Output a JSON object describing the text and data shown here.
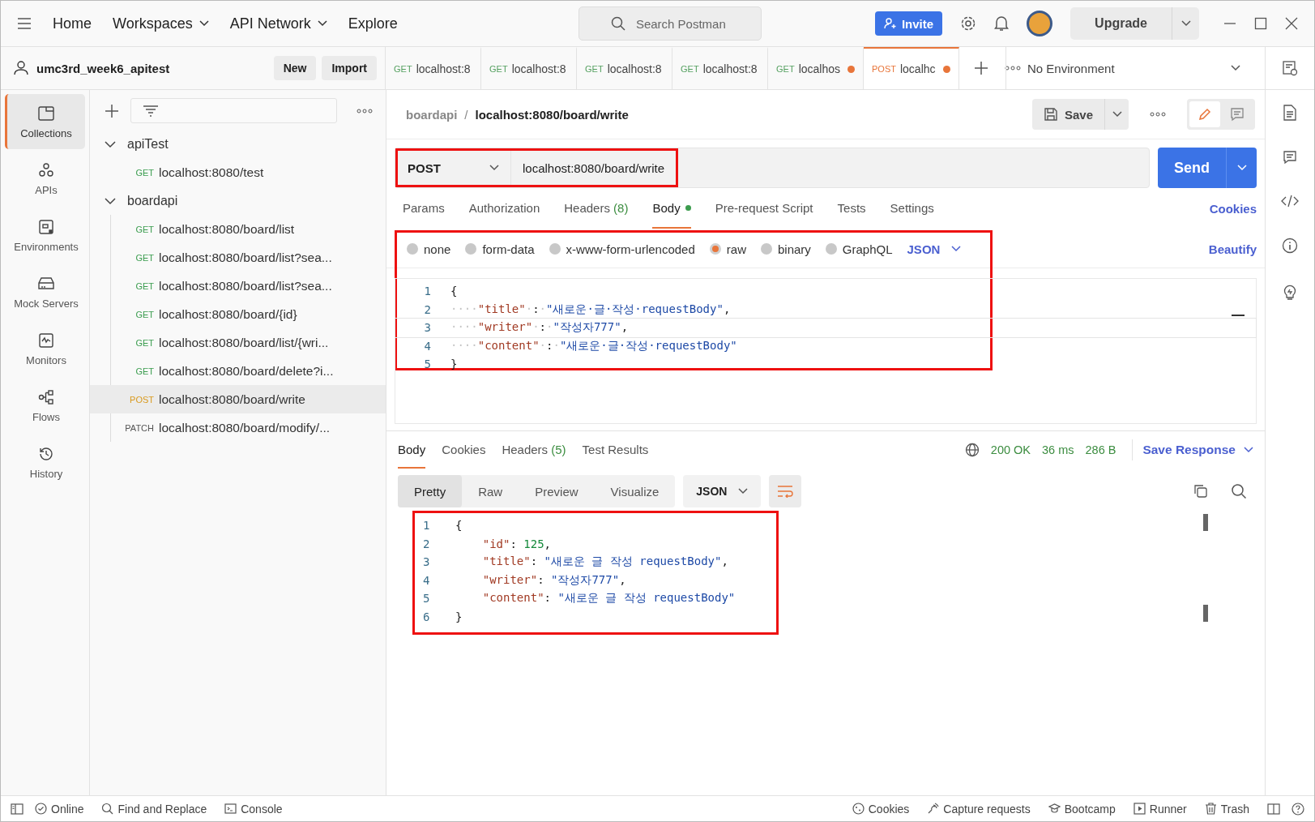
{
  "top_bar": {
    "nav": [
      {
        "label": "Home",
        "dropdown": false
      },
      {
        "label": "Workspaces",
        "dropdown": true
      },
      {
        "label": "API Network",
        "dropdown": true
      },
      {
        "label": "Explore",
        "dropdown": false
      }
    ],
    "search": {
      "placeholder": "Search Postman"
    },
    "invite": "Invite",
    "upgrade": "Upgrade"
  },
  "workspace": {
    "name": "umc3rd_week6_apitest",
    "buttons": [
      "New",
      "Import"
    ]
  },
  "request_tabs": [
    {
      "method": "GET",
      "label": "localhost:8",
      "unsaved": false,
      "selected": false
    },
    {
      "method": "GET",
      "label": "localhost:8",
      "unsaved": false,
      "selected": false
    },
    {
      "method": "GET",
      "label": "localhost:8",
      "unsaved": false,
      "selected": false
    },
    {
      "method": "GET",
      "label": "localhost:8",
      "unsaved": false,
      "selected": false
    },
    {
      "method": "GET",
      "label": "localhos",
      "unsaved": true,
      "selected": false
    },
    {
      "method": "POST",
      "label": "localhc",
      "unsaved": true,
      "selected": true
    }
  ],
  "environment": "No Environment",
  "sidebar_nav": [
    {
      "label": "Collections",
      "selected": true
    },
    {
      "label": "APIs",
      "selected": false
    },
    {
      "label": "Environments",
      "selected": false
    },
    {
      "label": "Mock Servers",
      "selected": false
    },
    {
      "label": "Monitors",
      "selected": false
    },
    {
      "label": "Flows",
      "selected": false
    },
    {
      "label": "History",
      "selected": false
    }
  ],
  "collections": [
    {
      "name": "apiTest",
      "expanded": true,
      "children": [
        {
          "method": "GET",
          "label": "localhost:8080/test",
          "selected": false
        }
      ]
    },
    {
      "name": "boardapi",
      "expanded": true,
      "children": [
        {
          "method": "GET",
          "label": "localhost:8080/board/list",
          "selected": false
        },
        {
          "method": "GET",
          "label": "localhost:8080/board/list?sea...",
          "selected": false
        },
        {
          "method": "GET",
          "label": "localhost:8080/board/list?sea...",
          "selected": false
        },
        {
          "method": "GET",
          "label": "localhost:8080/board/{id}",
          "selected": false
        },
        {
          "method": "GET",
          "label": "localhost:8080/board/list/{wri...",
          "selected": false
        },
        {
          "method": "GET",
          "label": "localhost:8080/board/delete?i...",
          "selected": false
        },
        {
          "method": "POST",
          "label": "localhost:8080/board/write",
          "selected": true
        },
        {
          "method": "PATCH",
          "label": "localhost:8080/board/modify/...",
          "selected": false
        }
      ]
    }
  ],
  "request": {
    "breadcrumb": {
      "collection": "boardapi",
      "separator": "/",
      "name": "localhost:8080/board/write"
    },
    "save": "Save",
    "modes": [
      {
        "kind": "edit",
        "selected": true
      },
      {
        "kind": "comment",
        "selected": false
      }
    ],
    "method": "POST",
    "url": "localhost:8080/board/write",
    "url_highlighted": true,
    "send": "Send",
    "tabs": [
      {
        "label": "Params",
        "dot": false,
        "selected": false
      },
      {
        "label": "Authorization",
        "dot": false,
        "selected": false
      },
      {
        "label": "Headers",
        "count": "(8)",
        "dot": false,
        "selected": false
      },
      {
        "label": "Body",
        "dot": true,
        "selected": true
      },
      {
        "label": "Pre-request Script",
        "dot": false,
        "selected": false
      },
      {
        "label": "Tests",
        "dot": false,
        "selected": false
      },
      {
        "label": "Settings",
        "dot": false,
        "selected": false
      }
    ],
    "cookies_link": "Cookies",
    "body_types": [
      {
        "label": "none",
        "selected": false
      },
      {
        "label": "form-data",
        "selected": false
      },
      {
        "label": "x-www-form-urlencoded",
        "selected": false
      },
      {
        "label": "raw",
        "selected": true
      },
      {
        "label": "binary",
        "selected": false
      },
      {
        "label": "GraphQL",
        "selected": false
      }
    ],
    "language": "JSON",
    "beautify": "Beautify",
    "body_highlighted": true,
    "body_lines": [
      {
        "no": "1",
        "active": false,
        "tokens": [
          {
            "kind": "punct",
            "text": "{"
          }
        ]
      },
      {
        "no": "2",
        "active": false,
        "tokens": [
          {
            "kind": "ws",
            "text": "····"
          },
          {
            "kind": "key",
            "text": "\"title\""
          },
          {
            "kind": "ws",
            "text": "·"
          },
          {
            "kind": "punct",
            "text": ":"
          },
          {
            "kind": "ws",
            "text": "·"
          },
          {
            "kind": "string",
            "text": "\"새로운·글·작성·requestBody\""
          },
          {
            "kind": "punct",
            "text": ","
          }
        ]
      },
      {
        "no": "3",
        "active": true,
        "tokens": [
          {
            "kind": "ws",
            "text": "····"
          },
          {
            "kind": "key",
            "text": "\"writer\""
          },
          {
            "kind": "ws",
            "text": "·"
          },
          {
            "kind": "punct",
            "text": ":"
          },
          {
            "kind": "ws",
            "text": "·"
          },
          {
            "kind": "string",
            "text": "\"작성자777\""
          },
          {
            "kind": "punct",
            "text": ","
          }
        ]
      },
      {
        "no": "4",
        "active": false,
        "tokens": [
          {
            "kind": "ws",
            "text": "····"
          },
          {
            "kind": "key",
            "text": "\"content\""
          },
          {
            "kind": "ws",
            "text": "·"
          },
          {
            "kind": "punct",
            "text": ":"
          },
          {
            "kind": "ws",
            "text": "·"
          },
          {
            "kind": "string",
            "text": "\"새로운·글·작성·requestBody\""
          }
        ]
      },
      {
        "no": "5",
        "active": false,
        "tokens": [
          {
            "kind": "punct",
            "text": "}"
          }
        ]
      }
    ]
  },
  "response": {
    "tabs": [
      {
        "label": "Body",
        "selected": true
      },
      {
        "label": "Cookies",
        "selected": false
      },
      {
        "label": "Headers",
        "count": "(5)",
        "selected": false
      },
      {
        "label": "Test Results",
        "selected": false
      }
    ],
    "status": "200 OK",
    "time": "36 ms",
    "size": "286 B",
    "save_response": "Save Response",
    "views": [
      {
        "label": "Pretty",
        "selected": true
      },
      {
        "label": "Raw",
        "selected": false
      },
      {
        "label": "Preview",
        "selected": false
      },
      {
        "label": "Visualize",
        "selected": false
      }
    ],
    "language": "JSON",
    "highlighted": true,
    "lines": [
      {
        "no": "1",
        "tokens": [
          {
            "kind": "punct",
            "text": "{"
          }
        ]
      },
      {
        "no": "2",
        "tokens": [
          {
            "kind": "key",
            "text": "    \"id\""
          },
          {
            "kind": "punct",
            "text": ": "
          },
          {
            "kind": "number",
            "text": "125"
          },
          {
            "kind": "punct",
            "text": ","
          }
        ]
      },
      {
        "no": "3",
        "tokens": [
          {
            "kind": "key",
            "text": "    \"title\""
          },
          {
            "kind": "punct",
            "text": ": "
          },
          {
            "kind": "string",
            "text": "\"새로운 글 작성 requestBody\""
          },
          {
            "kind": "punct",
            "text": ","
          }
        ]
      },
      {
        "no": "4",
        "tokens": [
          {
            "kind": "key",
            "text": "    \"writer\""
          },
          {
            "kind": "punct",
            "text": ": "
          },
          {
            "kind": "string",
            "text": "\"작성자777\""
          },
          {
            "kind": "punct",
            "text": ","
          }
        ]
      },
      {
        "no": "5",
        "tokens": [
          {
            "kind": "key",
            "text": "    \"content\""
          },
          {
            "kind": "punct",
            "text": ": "
          },
          {
            "kind": "string",
            "text": "\"새로운 글 작성 requestBody\""
          }
        ]
      },
      {
        "no": "6",
        "tokens": [
          {
            "kind": "punct",
            "text": "}"
          }
        ]
      }
    ]
  },
  "status_bar": {
    "left": [
      "Online",
      "Find and Replace",
      "Console"
    ],
    "right": [
      "Cookies",
      "Capture requests",
      "Bootcamp",
      "Runner",
      "Trash"
    ]
  }
}
